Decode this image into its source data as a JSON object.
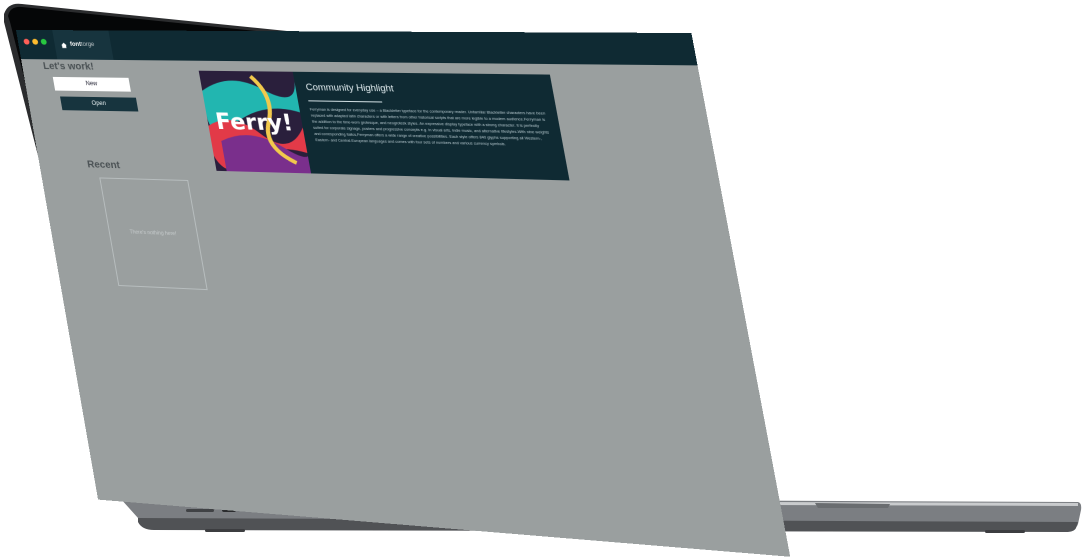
{
  "app": {
    "tab_brand": "font",
    "tab_sub": "forge"
  },
  "work": {
    "heading": "Let's work!",
    "new_label": "New",
    "open_label": "Open"
  },
  "highlight": {
    "title": "Community Highlight",
    "image_word": "Ferry!",
    "body": "Ferryman is designed for everyday use – a Blackletter typeface for the contemporary reader. Unfamiliar Blackletter characters have been replaced with adapted latin characters or with letters from other historical scripts that are more legible to a modern audience.Ferryman is the addition to the time-worn grotesque, and neogrotesk styles. An expressive display typeface with a strong character. It is perfectly suited for corporate signage, posters and progressive concepts e.g. in visual arts, indie music, and alternative lifestyles.With nine weights and corresponding italics,Ferryman offers a wide range of creative possibilities. Each style offers 840 glyphs supporting all Western-, Eastern- and Central-European languages and comes with four sets of numbers and various currency symbols."
  },
  "recent": {
    "heading": "Recent",
    "empty_text": "There's nothing here!"
  },
  "colors": {
    "screen_bg": "#9a9f9f",
    "dark_panel": "#0f2a33",
    "traffic_red": "#ff5f57",
    "traffic_yellow": "#febc2e",
    "traffic_green": "#28c840"
  },
  "icons": {
    "tab_icon": "house-icon"
  }
}
